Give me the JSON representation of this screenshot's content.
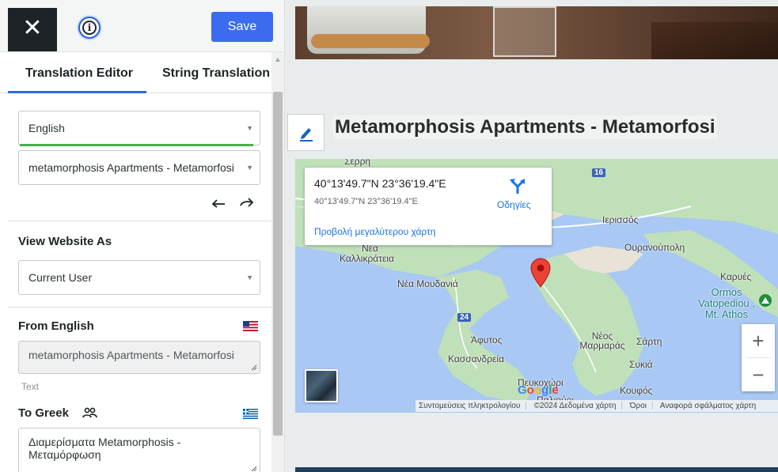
{
  "toolbar": {
    "close_glyph": "✕",
    "save_label": "Save",
    "info_glyph": "i"
  },
  "tabs": [
    {
      "label": "Translation Editor",
      "active": true
    },
    {
      "label": "String Translation",
      "active": false
    }
  ],
  "editor": {
    "language_select": "English",
    "string_select": "metamorphosis Apartments - Metamorfosi",
    "view_as_label": "View Website As",
    "view_as_select": "Current User",
    "from_label": "From English",
    "from_text": "metamorphosis Apartments - Metamorfosi",
    "text_type": "Text",
    "to_label": "To Greek",
    "to_text": "Διαμερίσματα Metamorphosis - Μεταμόρφωση",
    "caret": "▼"
  },
  "preview": {
    "heading": "Metamorphosis Apartments - Metamorfosi"
  },
  "map": {
    "coord_main": "40°13'49.7\"N 23°36'19.4\"E",
    "coord_sub": "40°13'49.7\"N 23°36'19.4\"E",
    "directions_label": "Οδηγίες",
    "larger_map_link": "Προβολή μεγαλύτερου χάρτη",
    "places": {
      "serri": "Σερρη",
      "ierissos": "Ιερισσός",
      "nea": "Νέα",
      "kallikrateia": "Καλλικράτεια",
      "ouranoupoli": "Ουρανούπολη",
      "nea_moudania": "Νέα Μουδανιά",
      "karyes": "Καρυές",
      "ormos": "Ormos Vatopediou , Mt. Athos",
      "afytos": "Άφυτος",
      "neos_marmaras": "Νέος Μαρμαράς",
      "sarti": "Σάρτη",
      "kassandreia": "Κασσανδρεία",
      "sykia": "Συκιά",
      "pefkochori": "Πευκοχώρι",
      "koufos": "Κουφός",
      "paliouri": "Παλιούρι"
    },
    "road_16": "16",
    "road_24": "24",
    "zoom_in": "+",
    "zoom_out": "−",
    "google_logo": "Google",
    "attribution": {
      "shortcuts": "Συντομεύσεις πληκτρολογίου",
      "data": "©2024 Δεδομένα χάρτη",
      "terms": "Όροι",
      "report": "Αναφορά σφάλματος χάρτη"
    }
  },
  "colors": {
    "save_button": "#3b6cf0",
    "tab_underline": "#2b6cdc",
    "language_underline": "#4caf50",
    "map_water": "#a9c8f3",
    "map_pin": "#ea4335",
    "link": "#1a73e8"
  }
}
